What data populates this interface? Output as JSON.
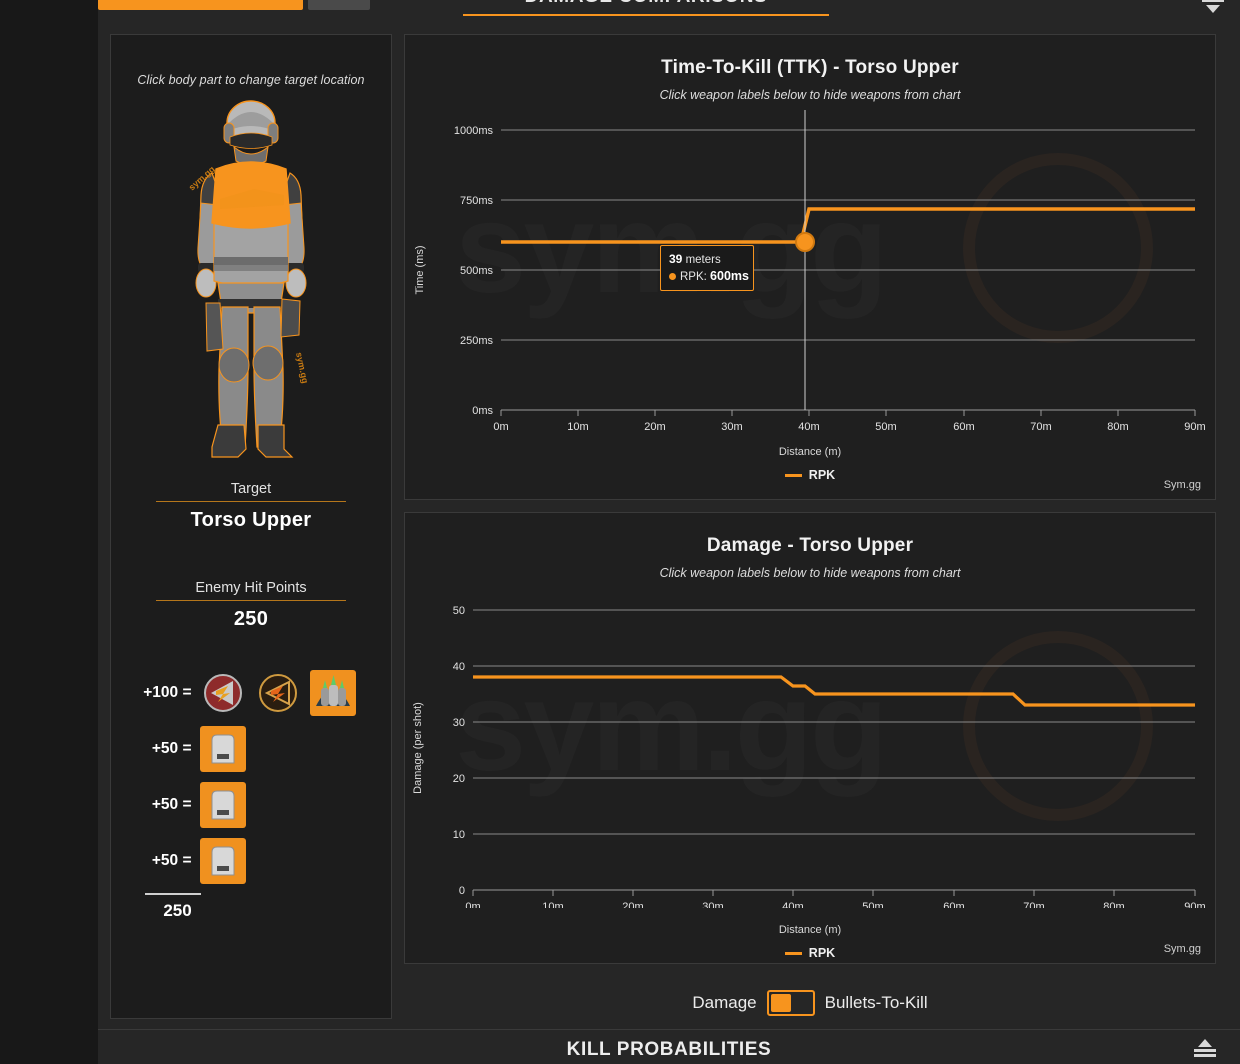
{
  "topbar": {
    "tab_active_label": "",
    "tab_inactive_label": "",
    "section_title": "DAMAGE COMPARISONS",
    "collapse_icon": "collapse-icon"
  },
  "left_panel": {
    "hint": "Click body part to change target location",
    "figure_watermark": "sym.gg",
    "target": {
      "label": "Target",
      "value": "Torso Upper"
    },
    "hit_points": {
      "label": "Enemy Hit Points",
      "value": "250"
    },
    "armor_rows": [
      {
        "eq": "+100 =",
        "icons": [
          "health-class-icon-1",
          "health-class-icon-2",
          "health-class-icon-3"
        ],
        "selected_index": 2
      },
      {
        "eq": "+50 =",
        "icons": [
          "armor-plate-icon"
        ],
        "selected_index": 0
      },
      {
        "eq": "+50 =",
        "icons": [
          "armor-plate-icon"
        ],
        "selected_index": 0
      },
      {
        "eq": "+50 =",
        "icons": [
          "armor-plate-icon"
        ],
        "selected_index": 0
      }
    ],
    "armor_total": "250"
  },
  "ttk_chart": {
    "title": "Time-To-Kill (TTK) - Torso Upper",
    "subtitle": "Click weapon labels below to hide weapons from chart",
    "legend": [
      {
        "label": "RPK",
        "color": "#f7941e"
      }
    ],
    "brand": "Sym.gg",
    "tooltip": {
      "distance": "39",
      "distance_unit": "meters",
      "series": "RPK",
      "value": "600ms"
    }
  },
  "damage_chart": {
    "title": "Damage - Torso Upper",
    "subtitle": "Click weapon labels below to hide weapons from chart",
    "legend": [
      {
        "label": "RPK",
        "color": "#f7941e"
      }
    ],
    "brand": "Sym.gg"
  },
  "toggle": {
    "left_label": "Damage",
    "right_label": "Bullets-To-Kill",
    "state": "Damage"
  },
  "bottom": {
    "title": "KILL PROBABILITIES",
    "expand_icon": "expand-icon"
  },
  "colors": {
    "accent": "#f7941e",
    "panel": "#1f1f1f",
    "background": "#262626",
    "text": "#ededed"
  },
  "chart_data": [
    {
      "type": "line",
      "id": "ttk",
      "title": "Time-To-Kill (TTK) - Torso Upper",
      "subtitle": "Click weapon labels below to hide weapons from chart",
      "xlabel": "Distance (m)",
      "ylabel": "Time (ms)",
      "xlim": [
        0,
        90
      ],
      "ylim": [
        0,
        1000
      ],
      "xticks": [
        0,
        10,
        20,
        30,
        40,
        50,
        60,
        70,
        80,
        90
      ],
      "xticklabels": [
        "0m",
        "10m",
        "20m",
        "30m",
        "40m",
        "50m",
        "60m",
        "70m",
        "80m",
        "90m"
      ],
      "yticks": [
        0,
        250,
        500,
        750,
        1000
      ],
      "yticklabels": [
        "0ms",
        "250ms",
        "500ms",
        "750ms",
        "1000ms"
      ],
      "grid": "horizontal",
      "legend_position": "bottom",
      "series": [
        {
          "name": "RPK",
          "color": "#f7941e",
          "x": [
            0,
            39,
            39,
            90
          ],
          "values": [
            600,
            600,
            720,
            720
          ]
        }
      ],
      "annotations": [
        {
          "type": "crosshair",
          "x": 39
        },
        {
          "type": "marker",
          "x": 39,
          "y": 600
        },
        {
          "type": "tooltip",
          "x": 39,
          "text": "39 meters / RPK: 600ms"
        }
      ]
    },
    {
      "type": "line",
      "id": "damage",
      "title": "Damage - Torso Upper",
      "subtitle": "Click weapon labels below to hide weapons from chart",
      "xlabel": "Distance (m)",
      "ylabel": "Damage (per shot)",
      "xlim": [
        0,
        90
      ],
      "ylim": [
        0,
        50
      ],
      "xticks": [
        0,
        10,
        20,
        30,
        40,
        50,
        60,
        70,
        80,
        90
      ],
      "xticklabels": [
        "0m",
        "10m",
        "20m",
        "30m",
        "40m",
        "50m",
        "60m",
        "70m",
        "80m",
        "90m"
      ],
      "yticks": [
        0,
        10,
        20,
        30,
        40,
        50
      ],
      "yticklabels": [
        "0",
        "10",
        "20",
        "30",
        "40",
        "50"
      ],
      "grid": "horizontal",
      "legend_position": "bottom",
      "series": [
        {
          "name": "RPK",
          "color": "#f7941e",
          "x": [
            0,
            38,
            39,
            40,
            41,
            67,
            68,
            90
          ],
          "values": [
            38,
            38,
            36.5,
            36.5,
            35,
            35,
            33,
            33
          ]
        }
      ]
    }
  ]
}
